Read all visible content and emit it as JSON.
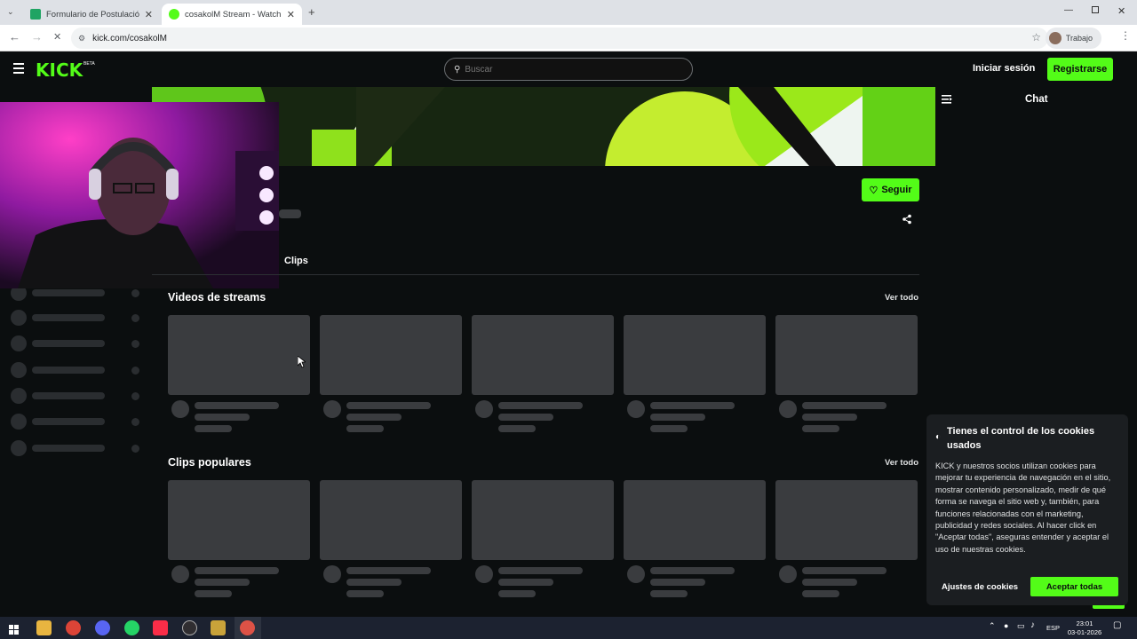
{
  "browser": {
    "tabs": [
      {
        "title": "Formulario de Postulación de J",
        "active": false,
        "favicon_color": "#1fa463"
      },
      {
        "title": "cosakolM Stream - Watch Live o",
        "active": true,
        "favicon_color": "#53fc18"
      }
    ],
    "url": "kick.com/cosakolM",
    "profile_label": "Trabajo"
  },
  "header": {
    "logo": "KICK",
    "beta": "BETA",
    "search_placeholder": "Buscar",
    "login_label": "Iniciar sesión",
    "register_label": "Registrarse"
  },
  "channel": {
    "follow_label": "Seguir",
    "tabs": [
      "Clips"
    ]
  },
  "sections": [
    {
      "title": "Videos de streams",
      "see_all": "Ver todo"
    },
    {
      "title": "Clips populares",
      "see_all": "Ver todo"
    }
  ],
  "chat": {
    "title": "Chat"
  },
  "cookie": {
    "title": "Tienes el control de los cookies usados",
    "body": "KICK y nuestros socios utilizan cookies para mejorar tu experiencia de navegación en el sitio, mostrar contenido personalizado, medir de qué forma se navega el sitio web y, también, para funciones relacionadas con el marketing, publicidad y redes sociales. Al hacer click en \"Aceptar todas\", aseguras entender y aceptar el uso de nuestras cookies.",
    "settings_label": "Ajustes de cookies",
    "accept_label": "Aceptar todas"
  },
  "taskbar": {
    "language": "ESP",
    "time": "23:01",
    "date": "03-01-2026"
  },
  "colors": {
    "brand": "#53fc18",
    "background": "#0b0e0f",
    "skeleton": "#3a3c3f"
  }
}
